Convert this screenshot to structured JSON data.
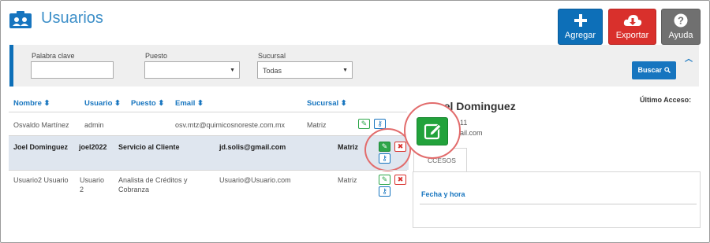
{
  "header": {
    "title": "Usuarios",
    "buttons": {
      "add_label": "Agregar",
      "export_label": "Exportar",
      "help_label": "Ayuda"
    }
  },
  "filters": {
    "keyword_label": "Palabra clave",
    "puesto_label": "Puesto",
    "puesto_value": "",
    "sucursal_label": "Sucursal",
    "sucursal_value": "Todas",
    "search_label": "Buscar"
  },
  "table": {
    "columns": [
      "Nombre",
      "Usuario",
      "Puesto",
      "Email",
      "Sucursal"
    ],
    "rows": [
      {
        "nombre": "Osvaldo Martínez",
        "usuario": "admin",
        "puesto": "",
        "email": "osv.mtz@quimicosnoreste.com.mx",
        "sucursal": "Matriz"
      },
      {
        "nombre": "Joel Dominguez",
        "usuario": "joel2022",
        "puesto": "Servicio al Cliente",
        "email": "jd.solis@gmail.com",
        "sucursal": "Matriz",
        "selected": true
      },
      {
        "nombre": "Usuario2 Usuario",
        "usuario_l1": "Usuario",
        "usuario_l2": "2",
        "puesto_l1": "Analista de Créditos y",
        "puesto_l2": "Cobranza",
        "email": "Usuario@Usuario.com",
        "sucursal": "Matriz"
      }
    ]
  },
  "detail": {
    "name": "Joel Dominguez",
    "last_access_label": "Último Acceso:",
    "phone_fragment": "11",
    "email_fragment": "ail.com",
    "tab_label": "CCESOS",
    "col_fecha": "Fecha y hora"
  },
  "icons": [
    "users-card-icon",
    "plus-icon",
    "cloud-download-icon",
    "question-icon",
    "search-icon",
    "chevron-up-icon",
    "sort-icon",
    "edit-icon",
    "delete-icon",
    "key-icon",
    "person-icon"
  ],
  "colors": {
    "primary": "#1775bf",
    "add": "#0d6fb8",
    "export": "#d9302c",
    "help": "#707070",
    "edit": "#2ea64a",
    "highlight": "#e26c6c"
  }
}
